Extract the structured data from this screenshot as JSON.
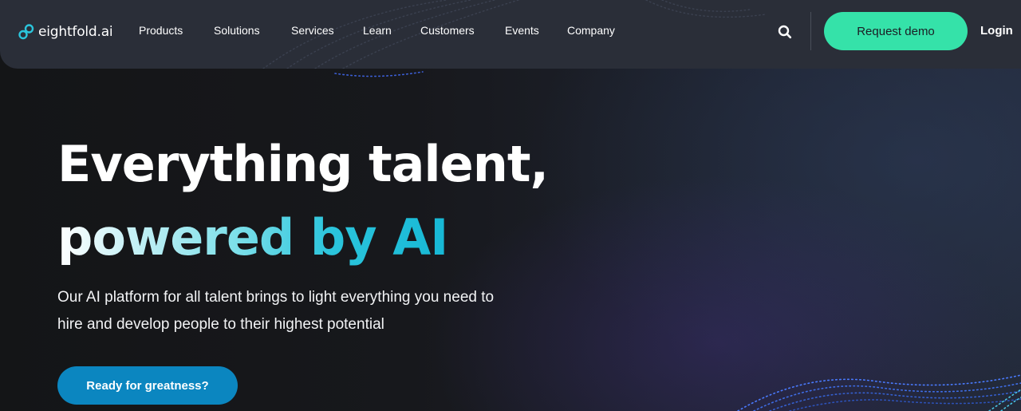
{
  "brand": {
    "logo_text": "eightfold.ai",
    "accent": "#35e2a9",
    "logo_color": "#2bc5dc"
  },
  "nav": {
    "items": [
      {
        "label": "Products"
      },
      {
        "label": "Solutions"
      },
      {
        "label": "Services"
      },
      {
        "label": "Learn"
      },
      {
        "label": "Customers"
      },
      {
        "label": "Events"
      },
      {
        "label": "Company"
      }
    ],
    "search_icon": "search-icon",
    "request_demo_label": "Request demo",
    "login_label": "Login"
  },
  "hero": {
    "headline_line1": "Everything talent,",
    "headline_line2": "powered by AI",
    "subtext": "Our AI platform for all talent brings to light everything you need to hire and develop people to their highest potential",
    "cta_label": "Ready for greatness?",
    "cta_color": "#0b86c0"
  }
}
